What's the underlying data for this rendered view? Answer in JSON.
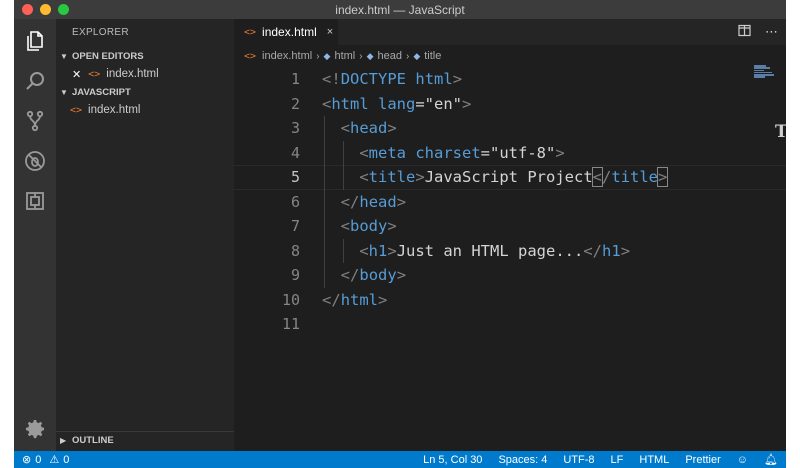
{
  "window": {
    "title": "index.html — JavaScript"
  },
  "sidebar": {
    "title": "EXPLORER",
    "open_editors": {
      "label": "OPEN EDITORS",
      "files": [
        "index.html"
      ]
    },
    "folder": {
      "label": "JAVASCRIPT",
      "files": [
        "index.html"
      ]
    },
    "outline": {
      "label": "OUTLINE"
    }
  },
  "tab": {
    "label": "index.html",
    "close_glyph": "×"
  },
  "breadcrumb": [
    "index.html",
    "html",
    "head",
    "title"
  ],
  "editor": {
    "lines": [
      "<!DOCTYPE html>",
      "<html lang=\"en\">",
      "  <head>",
      "    <meta charset=\"utf-8\">",
      "    <title>JavaScript Project</title>",
      "  </head>",
      "  <body>",
      "    <h1>Just an HTML page...</h1>",
      "  </body>",
      "</html>",
      ""
    ],
    "current_line": 5
  },
  "statusbar": {
    "errors": "0",
    "warnings": "0",
    "position": "Ln 5, Col 30",
    "spaces": "Spaces: 4",
    "encoding": "UTF-8",
    "eol": "LF",
    "language": "HTML",
    "formatter": "Prettier"
  },
  "icons": {
    "activity": [
      "files-icon",
      "search-icon",
      "source-control-icon",
      "debug-icon",
      "extensions-icon",
      "gear-icon"
    ]
  },
  "colors": {
    "status_bar": "#007acc",
    "tag": "#569cd6",
    "attribute": "#9cdcfe",
    "string": "#ce9178",
    "html_file": "#e37933"
  }
}
